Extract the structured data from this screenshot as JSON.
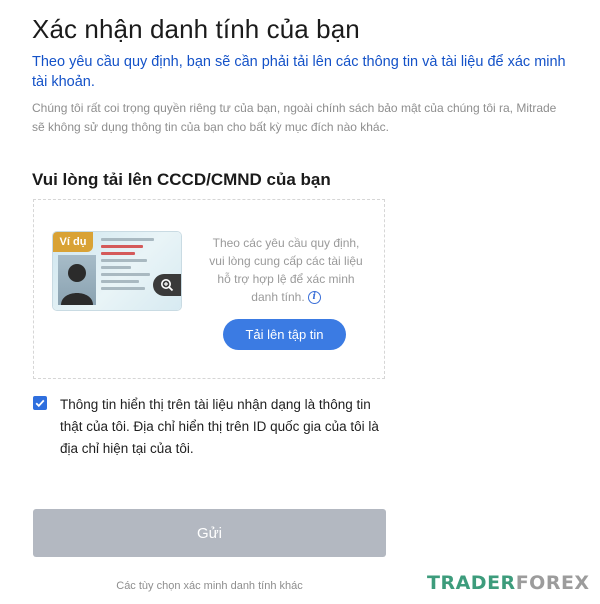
{
  "header": {
    "title": "Xác nhận danh tính của bạn",
    "subtitle": "Theo yêu cầu quy định, bạn sẽ cần phải tải lên các thông tin và tài liệu để xác minh tài khoản.",
    "privacy_note": "Chúng tôi rất coi trọng quyền riêng tư của bạn, ngoài chính sách bảo mật của chúng tôi ra, Mitrade sẽ không sử dụng thông tin của bạn cho bất kỳ mục đích nào khác."
  },
  "upload": {
    "section_title": "Vui lòng tải lên CCCD/CMND của bạn",
    "sample_tag": "Ví dụ",
    "hint": "Theo các yêu cầu quy định, vui lòng cung cấp các tài liệu hỗ trợ hợp lệ để xác minh danh tính.",
    "info_icon": "i",
    "button_label": "Tải lên tập tin"
  },
  "consent": {
    "checked": true,
    "text": "Thông tin hiển thị trên tài liệu nhận dạng là thông tin thật của tôi. Địa chỉ hiển thị trên ID quốc gia của tôi là địa chỉ hiện tại của tôi."
  },
  "actions": {
    "submit_label": "Gửi",
    "alt_link": "Các tùy chọn xác minh danh tính khác"
  },
  "watermark": {
    "part1": "TRADER",
    "part2": "FOREX"
  },
  "colors": {
    "subtitle": "#1452c8",
    "primary_button": "#3b7be3",
    "submit_disabled": "#b3b8c1",
    "checkbox": "#2f6fde"
  },
  "icons": [
    "zoom-icon",
    "info-icon",
    "checkmark-icon"
  ]
}
